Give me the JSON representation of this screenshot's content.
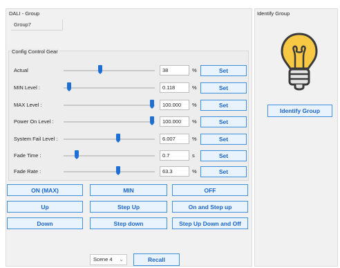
{
  "dali_group": {
    "title": "DALI - Group",
    "group_name": "Group7"
  },
  "identify": {
    "title": "Identify Group",
    "icon": "lightbulb-icon",
    "button_label": "Identify Group"
  },
  "config": {
    "title": "Config Control Gear",
    "rows": [
      {
        "label": "Actual",
        "value": "38",
        "unit": "%",
        "set_label": "Set",
        "slider_level": 0.38
      },
      {
        "label": "MIN Level :",
        "value": "0.118",
        "unit": "%",
        "set_label": "Set",
        "slider_level": 0.0
      },
      {
        "label": "MAX Level :",
        "value": "100.000",
        "unit": "%",
        "set_label": "Set",
        "slider_level": 1.0
      },
      {
        "label": "Power On Level :",
        "value": "100.000",
        "unit": "%",
        "set_label": "Set",
        "slider_level": 1.0
      },
      {
        "label": "System Fail Level :",
        "value": "6.007",
        "unit": "%",
        "set_label": "Set",
        "slider_level": 0.6
      },
      {
        "label": "Fade Time :",
        "value": "0.7",
        "unit": "s",
        "set_label": "Set",
        "slider_level": 0.1
      },
      {
        "label": "Fade Rate :",
        "value": "63.3",
        "unit": "%",
        "set_label": "Set",
        "slider_level": 0.6
      }
    ]
  },
  "commands": {
    "on_max": "ON (MAX)",
    "min": "MIN",
    "off": "OFF",
    "up": "Up",
    "step_up": "Step Up",
    "on_and_step_up": "On and Step up",
    "down": "Down",
    "step_down": "Step down",
    "step_up_down_and_off": "Step Up Down and Off"
  },
  "scene": {
    "selected": "Scene 4",
    "recall_label": "Recall"
  },
  "colors": {
    "accent": "#1d6fd6",
    "button_bg": "#e9f3fd",
    "button_border": "#3d8fe0",
    "panel_bg": "#f1f1f1"
  }
}
